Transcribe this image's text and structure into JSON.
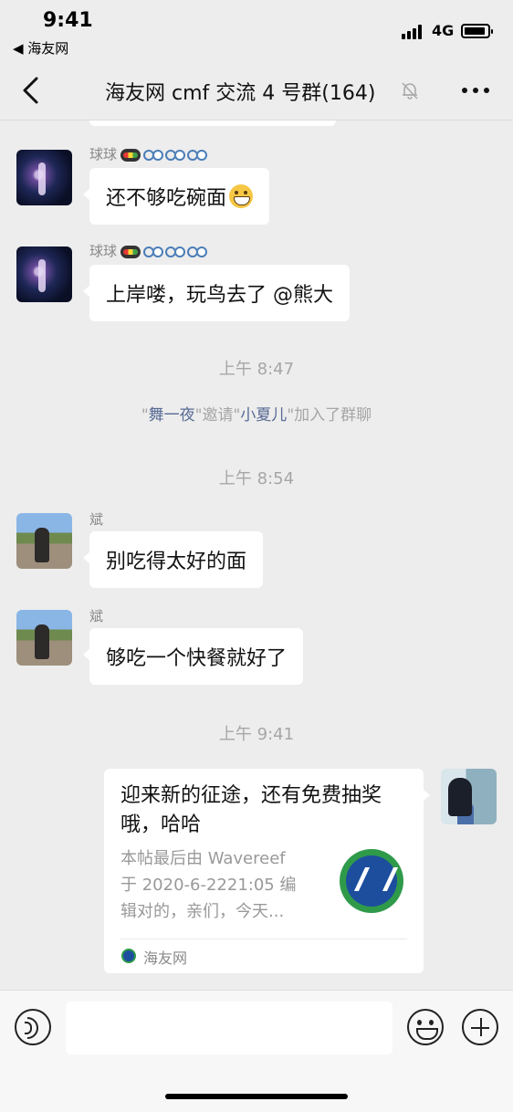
{
  "status_bar": {
    "time": "9:41",
    "back_app": "◀ 海友网",
    "network": "4G"
  },
  "nav": {
    "title": "海友网 cmf 交流 4 号群(164)"
  },
  "messages": [
    {
      "sender": "球球",
      "sender_emojis": [
        "traffic-light-icon",
        "bike-icon",
        "bike-icon",
        "bike-icon"
      ],
      "text": "还不够吃碗面",
      "trailing_emoji": "grin-icon"
    },
    {
      "sender": "球球",
      "sender_emojis": [
        "traffic-light-icon",
        "bike-icon",
        "bike-icon",
        "bike-icon"
      ],
      "text": "上岸喽，玩鸟去了 @熊大"
    },
    {
      "sender": "斌",
      "text": "别吃得太好的面"
    },
    {
      "sender": "斌",
      "text": "够吃一个快餐就好了"
    }
  ],
  "timestamps": [
    "上午 8:47",
    "上午 8:54",
    "上午 9:41"
  ],
  "system_notice": {
    "quote_open": "\"",
    "inviter": "舞一夜",
    "middle": "\"邀请\"",
    "invitee": "小夏儿",
    "suffix": "\"加入了群聊"
  },
  "link_card": {
    "title": "迎来新的征途，还有免费抽奖哦，哈哈",
    "desc_lines": [
      "本帖最后由 Wavereef",
      "于 2020-6-2221:05 编",
      "辑对的，亲们，今天..."
    ],
    "source": "海友网",
    "logo": "haiyouwang-logo"
  },
  "input_bar": {
    "voice_icon": "voice-icon",
    "emoji_icon": "emoji-icon",
    "plus_icon": "plus-icon"
  },
  "colors": {
    "background": "#ededed",
    "bubble": "#ffffff",
    "link_name": "#576b95",
    "meta_text": "#a6a6a6"
  }
}
